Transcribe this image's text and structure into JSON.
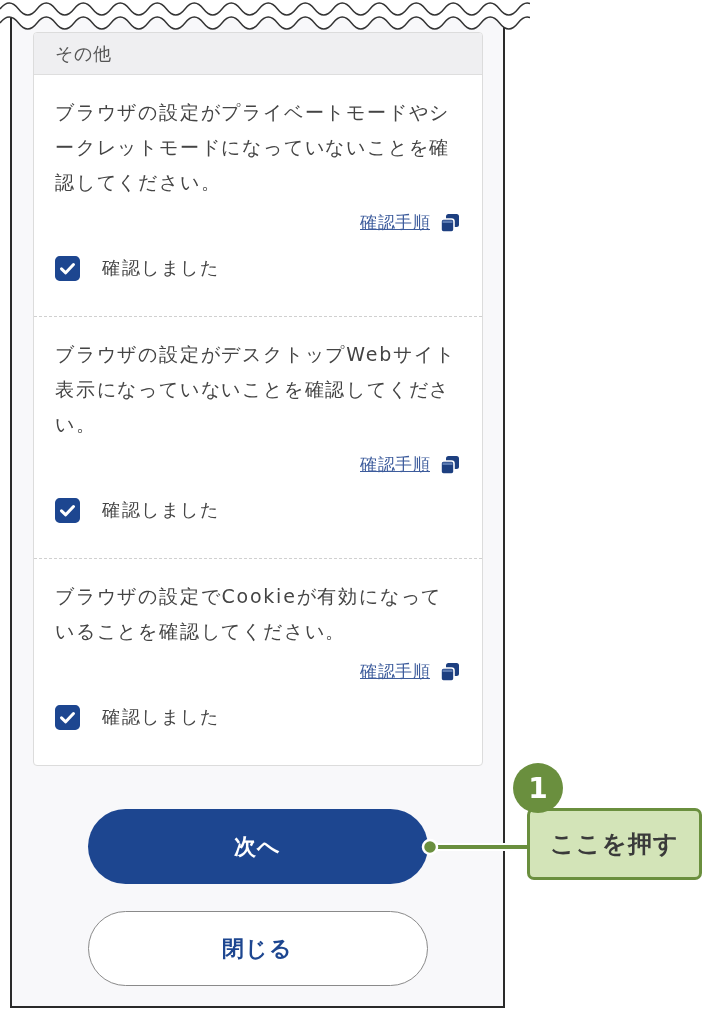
{
  "section": {
    "title": "その他",
    "items": [
      {
        "text": "ブラウザの設定がプライベートモードやシークレットモードになっていないことを確認してください。",
        "link": "確認手順",
        "checkbox": {
          "label": "確認しました",
          "checked": true
        }
      },
      {
        "text": "ブラウザの設定がデスクトップWebサイト表示になっていないことを確認してください。",
        "link": "確認手順",
        "checkbox": {
          "label": "確認しました",
          "checked": true
        }
      },
      {
        "text": "ブラウザの設定でCookieが有効になっていることを確認してください。",
        "link": "確認手順",
        "checkbox": {
          "label": "確認しました",
          "checked": true
        }
      }
    ]
  },
  "buttons": [
    {
      "label": "次へ",
      "kind": "primary"
    },
    {
      "label": "閉じる",
      "kind": "secondary"
    }
  ],
  "callout": {
    "number": "1",
    "text": "ここを押す"
  }
}
